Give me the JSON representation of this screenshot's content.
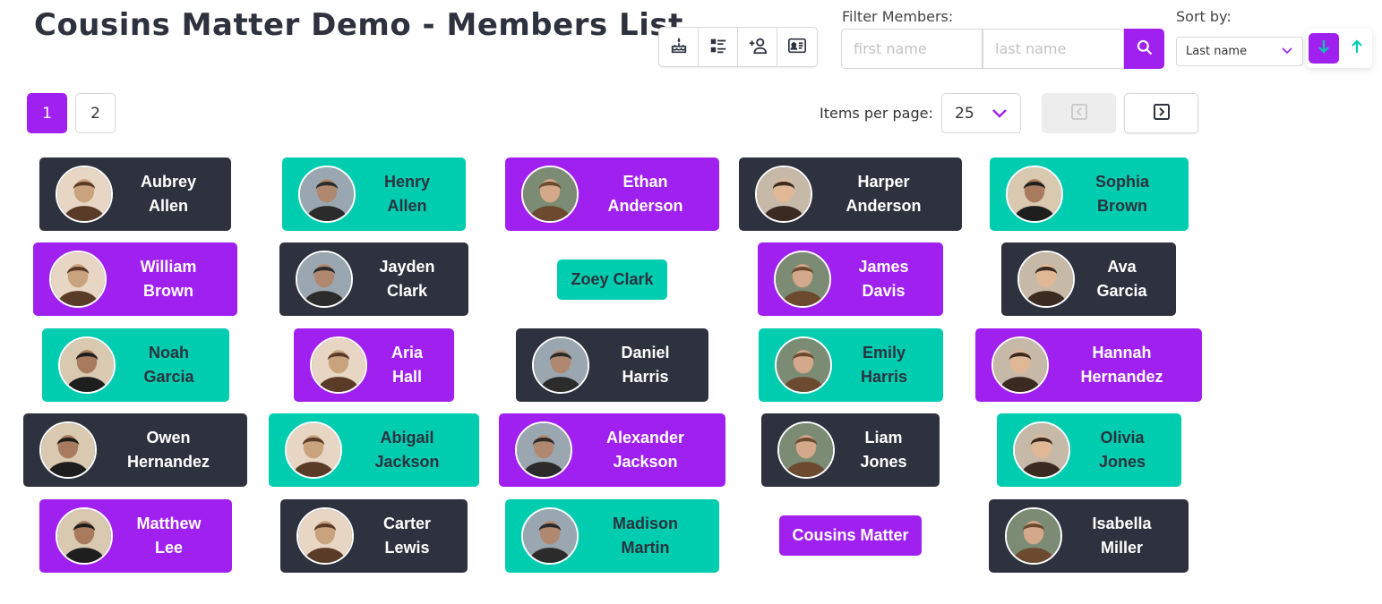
{
  "header": {
    "title": "Cousins Matter Demo - Members List"
  },
  "toolbar": {
    "icons": [
      "birthday-cake-icon",
      "list-icon",
      "add-user-icon",
      "id-card-icon"
    ]
  },
  "filter": {
    "label": "Filter Members:",
    "first_name_placeholder": "first name",
    "last_name_placeholder": "last name",
    "first_name_value": "",
    "last_name_value": ""
  },
  "sort": {
    "label": "Sort by:",
    "selected": "Last name",
    "direction": "descending"
  },
  "pagination": {
    "pages": [
      "1",
      "2"
    ],
    "current_page": "1",
    "items_per_page_label": "Items per page:",
    "items_per_page": "25"
  },
  "colors": {
    "accent": "#a020f0",
    "teal": "#00cdb0",
    "dark": "#2d323e"
  },
  "members": [
    {
      "name": "Aubrey Allen",
      "color": "dark",
      "has_avatar": true
    },
    {
      "name": "Henry Allen",
      "color": "teal",
      "has_avatar": true
    },
    {
      "name": "Ethan Anderson",
      "color": "purple",
      "has_avatar": true
    },
    {
      "name": "Harper Anderson",
      "color": "dark",
      "has_avatar": true
    },
    {
      "name": "Sophia Brown",
      "color": "teal",
      "has_avatar": true
    },
    {
      "name": "William Brown",
      "color": "purple",
      "has_avatar": true
    },
    {
      "name": "Jayden Clark",
      "color": "dark",
      "has_avatar": true
    },
    {
      "name": "Zoey Clark",
      "color": "teal",
      "has_avatar": false
    },
    {
      "name": "James Davis",
      "color": "purple",
      "has_avatar": true
    },
    {
      "name": "Ava Garcia",
      "color": "dark",
      "has_avatar": true
    },
    {
      "name": "Noah Garcia",
      "color": "teal",
      "has_avatar": true
    },
    {
      "name": "Aria Hall",
      "color": "purple",
      "has_avatar": true
    },
    {
      "name": "Daniel Harris",
      "color": "dark",
      "has_avatar": true
    },
    {
      "name": "Emily Harris",
      "color": "teal",
      "has_avatar": true
    },
    {
      "name": "Hannah Hernandez",
      "color": "purple",
      "has_avatar": true
    },
    {
      "name": "Owen Hernandez",
      "color": "dark",
      "has_avatar": true
    },
    {
      "name": "Abigail Jackson",
      "color": "teal",
      "has_avatar": true
    },
    {
      "name": "Alexander Jackson",
      "color": "purple",
      "has_avatar": true
    },
    {
      "name": "Liam Jones",
      "color": "dark",
      "has_avatar": true
    },
    {
      "name": "Olivia Jones",
      "color": "teal",
      "has_avatar": true
    },
    {
      "name": "Matthew Lee",
      "color": "purple",
      "has_avatar": true
    },
    {
      "name": "Carter Lewis",
      "color": "dark",
      "has_avatar": true
    },
    {
      "name": "Madison Martin",
      "color": "teal",
      "has_avatar": true
    },
    {
      "name": "Cousins Matter",
      "color": "purple",
      "has_avatar": false
    },
    {
      "name": "Isabella Miller",
      "color": "dark",
      "has_avatar": true
    }
  ]
}
